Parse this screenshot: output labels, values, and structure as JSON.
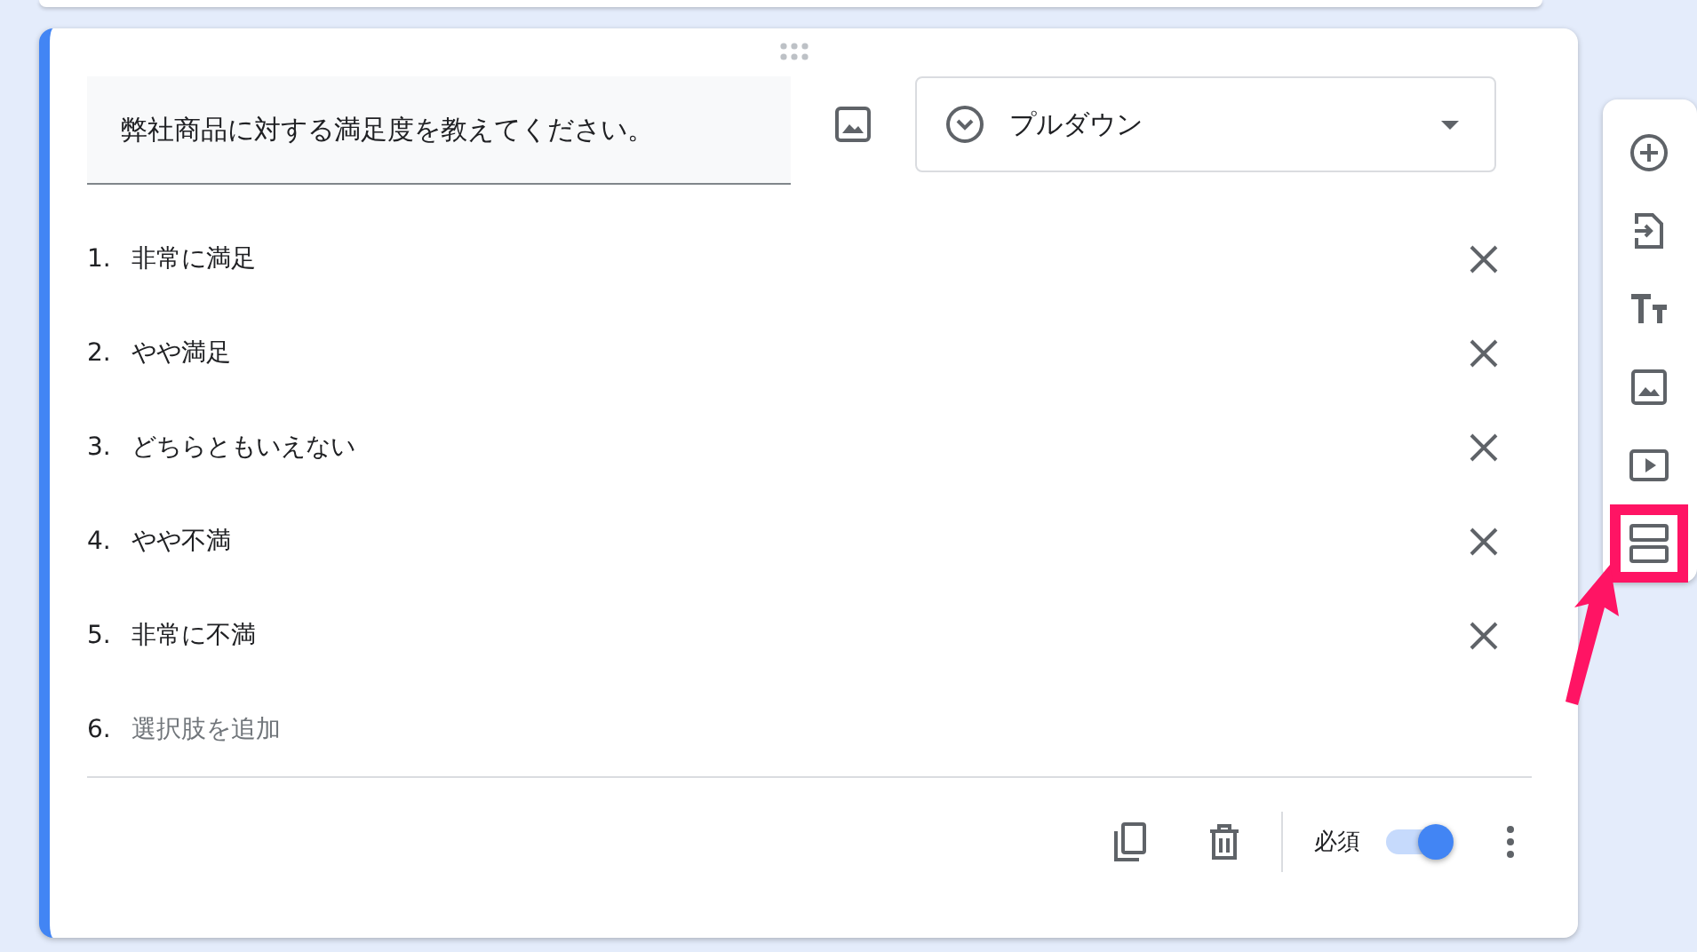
{
  "question": {
    "title": "弊社商品に対する満足度を教えてください。"
  },
  "type_select": {
    "value": "プルダウン"
  },
  "options": [
    {
      "kind": "option",
      "number": "1.",
      "label": "非常に満足"
    },
    {
      "kind": "option",
      "number": "2.",
      "label": "やや満足"
    },
    {
      "kind": "option",
      "number": "3.",
      "label": "どちらともいえない"
    },
    {
      "kind": "option",
      "number": "4.",
      "label": "やや不満"
    },
    {
      "kind": "option",
      "number": "5.",
      "label": "非常に不満"
    },
    {
      "kind": "add",
      "number": "6.",
      "label": "選択肢を追加"
    }
  ],
  "footer": {
    "required_label": "必須",
    "required": true
  },
  "side_tools": [
    {
      "kind": "add",
      "highlighted": false
    },
    {
      "kind": "import",
      "highlighted": false
    },
    {
      "kind": "title",
      "highlighted": false
    },
    {
      "kind": "image",
      "highlighted": false
    },
    {
      "kind": "video",
      "highlighted": false
    },
    {
      "kind": "section",
      "highlighted": true
    }
  ]
}
